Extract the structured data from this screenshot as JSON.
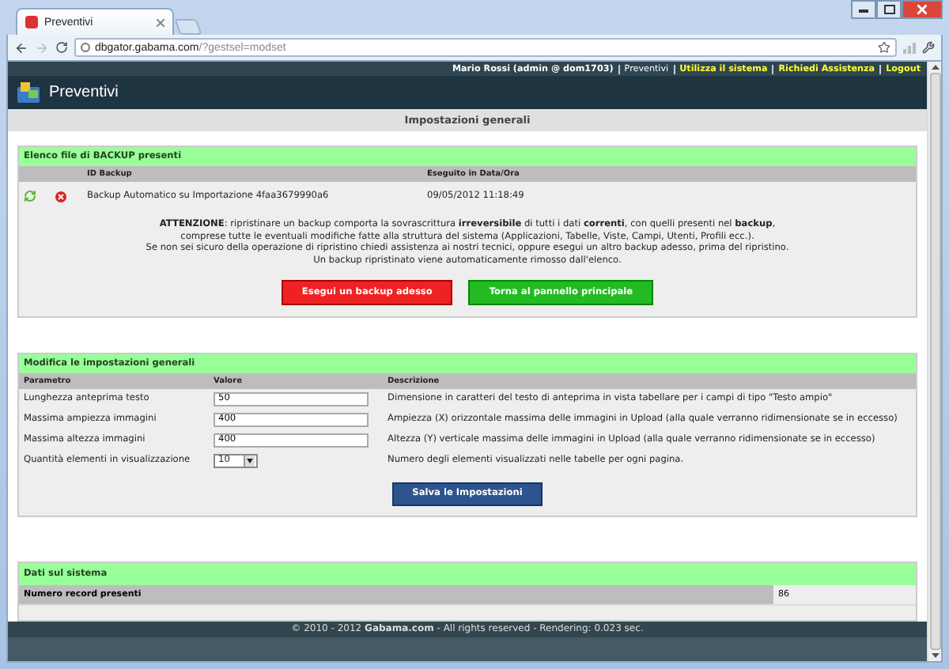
{
  "browser": {
    "tab_title": "Preventivi",
    "url_host": "dbgator.gabama.com",
    "url_path": "/?gestsel=modset"
  },
  "nav": {
    "user": "Mario Rossi (admin @ dom1703)",
    "links": [
      {
        "label": "Preventivi",
        "selected": true
      },
      {
        "label": "Utilizza il sistema",
        "selected": false
      },
      {
        "label": "Richiedi Assistenza",
        "selected": false
      },
      {
        "label": "Logout",
        "selected": false
      }
    ]
  },
  "header": {
    "title": "Preventivi"
  },
  "page_title": "Impostazioni generali",
  "backups": {
    "title": "Elenco file di BACKUP presenti",
    "columns": [
      "ID Backup",
      "Eseguito in Data/Ora"
    ],
    "rows": [
      {
        "id": "Backup Automatico su Importazione 4faa3679990a6",
        "datetime": "09/05/2012 11:18:49"
      }
    ],
    "warning": [
      "**ATTENZIONE**: ripristinare un backup comporta la sovrascrittura **irreversibile** di tutti i dati **correnti**, con quelli presenti nel **backup**,",
      "comprese tutte le eventuali modifiche fatte alla struttura del sistema (Applicazioni, Tabelle, Viste, Campi, Utenti, Profili ecc.).",
      "Se non sei sicuro della operazione di ripristino chiedi assistenza ai nostri tecnici, oppure esegui un altro backup adesso, prima del ripristino.",
      "Un backup ripristinato viene automaticamente rimosso dall'elenco."
    ],
    "buttons": [
      {
        "label": "Esegui un backup adesso",
        "kind": "danger"
      },
      {
        "label": "Torna al pannello principale",
        "kind": "success"
      }
    ]
  },
  "settings": {
    "title": "Modifica le impostazioni generali",
    "columns": [
      "Parametro",
      "Valore",
      "Descrizione"
    ],
    "rows": [
      {
        "parameter": "Lunghezza anteprima testo",
        "kind": "text",
        "value": "50",
        "description": "Dimensione in caratteri del testo di anteprima in vista tabellare per i campi di tipo \"Testo ampio\""
      },
      {
        "parameter": "Massima ampiezza immagini",
        "kind": "text",
        "value": "400",
        "description": "Ampiezza (X) orizzontale massima delle immagini in Upload (alla quale verranno ridimensionate se in eccesso)"
      },
      {
        "parameter": "Massima altezza immagini",
        "kind": "text",
        "value": "400",
        "description": "Altezza (Y) verticale massima delle immagini in Upload (alla quale verranno ridimensionate se in eccesso)"
      },
      {
        "parameter": "Quantità elementi in visualizzazione",
        "kind": "select",
        "value": "10",
        "description": "Numero degli elementi visualizzati nelle tabelle per ogni pagina."
      }
    ],
    "save_button": "Salva le Impostazioni"
  },
  "system": {
    "title": "Dati sul sistema",
    "rows": [
      {
        "label": "Numero record presenti",
        "value": "86"
      }
    ]
  },
  "footer": "© 2010 - 2012 **Gabama.com** - All rights reserved - Rendering: 0.023 sec."
}
